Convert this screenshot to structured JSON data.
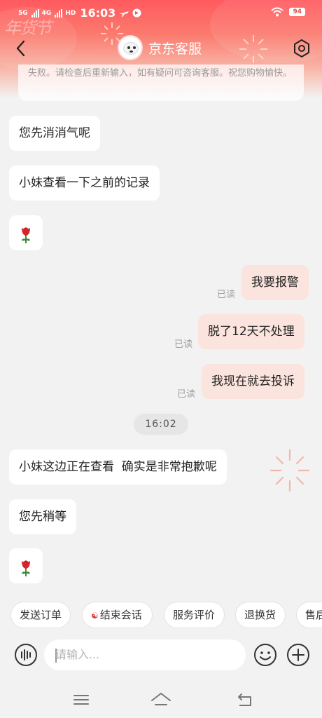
{
  "status_bar": {
    "net1": "5G",
    "net2": "4G",
    "hd": "HD",
    "time": "16:03",
    "battery": "94"
  },
  "header": {
    "festival_mark": "年货节",
    "title": "京东客服"
  },
  "notice_text": "失败。请检查后重新输入，如有疑问可咨询客服。祝您购物愉快。",
  "messages": [
    {
      "text": "您先消消气呢"
    },
    {
      "text": "小妹查看一下之前的记录"
    },
    {
      "emoji": "🌹"
    },
    {
      "text": "我要报警",
      "status": "已读"
    },
    {
      "text": "脱了12天不处理",
      "status": "已读"
    },
    {
      "text": "我现在就去投诉",
      "status": "已读"
    },
    {
      "time": "16:02"
    },
    {
      "text": "小妹这边正在查看  确实是非常抱歉呢"
    },
    {
      "text": "您先稍等"
    },
    {
      "emoji": "🌹"
    }
  ],
  "quick_actions": [
    "发送订单",
    "结束会话",
    "服务评价",
    "退换货",
    "售后"
  ],
  "input": {
    "placeholder": "请输入..."
  },
  "colors": {
    "header_red": "#ff5a5f",
    "outgoing_bubble": "#fbe4dd",
    "background": "#f2f2f2"
  },
  "icons": [
    "back-icon",
    "settings-icon",
    "voice-icon",
    "emoji-face-icon",
    "plus-icon",
    "menu-icon",
    "home-icon",
    "back-nav-icon"
  ]
}
